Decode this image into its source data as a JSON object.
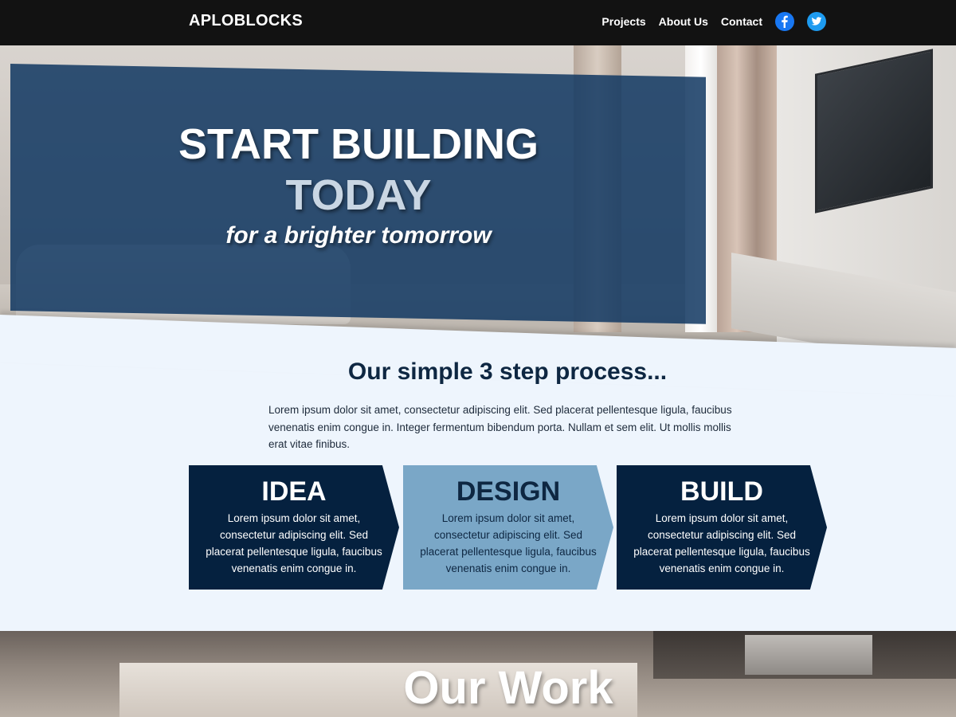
{
  "nav": {
    "brand": "APLOBLOCKS",
    "links": [
      "Projects",
      "About Us",
      "Contact"
    ],
    "social": [
      "facebook-icon",
      "twitter-icon"
    ]
  },
  "hero": {
    "line1": "START BUILDING",
    "line2": "TODAY",
    "tagline": "for a brighter tomorrow"
  },
  "process": {
    "title": "Our simple 3 step process...",
    "intro": "Lorem ipsum dolor sit amet, consectetur adipiscing elit. Sed placerat pellentesque ligula, faucibus venenatis enim congue in. Integer fermentum bibendum porta. Nullam et sem elit. Ut mollis mollis erat vitae finibus.",
    "steps": [
      {
        "title": "IDEA",
        "body": "Lorem ipsum dolor sit amet, consectetur adipiscing elit. Sed placerat pellentesque ligula, faucibus venenatis enim congue in."
      },
      {
        "title": "DESIGN",
        "body": "Lorem ipsum dolor sit amet, consectetur adipiscing elit. Sed placerat pellentesque ligula, faucibus venenatis enim congue in."
      },
      {
        "title": "BUILD",
        "body": "Lorem ipsum dolor sit amet, consectetur adipiscing elit. Sed placerat pellentesque ligula, faucibus venenatis enim congue in."
      }
    ]
  },
  "work": {
    "title": "Our Work"
  },
  "colors": {
    "nav_bg": "#121212",
    "navy": "#05213f",
    "light_blue": "#7aa7c7",
    "page_bg": "#eef5fd"
  }
}
